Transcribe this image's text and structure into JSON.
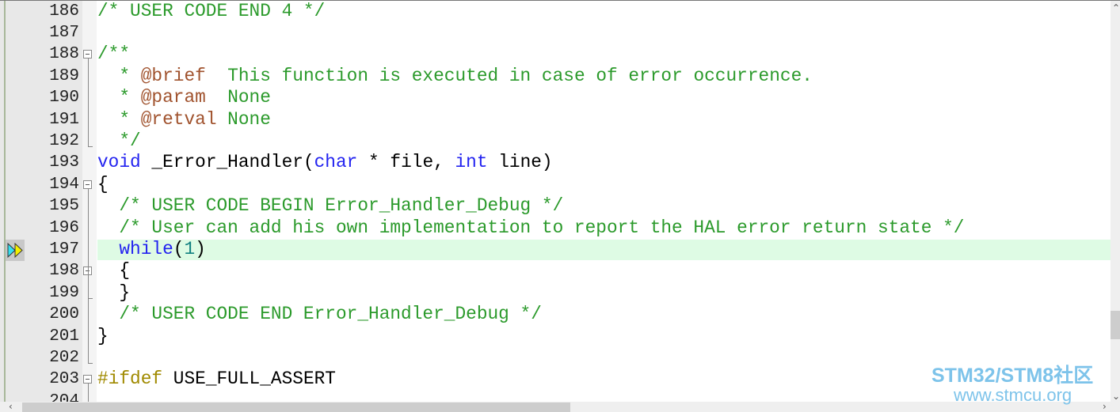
{
  "editor": {
    "current_line": 197,
    "lines": [
      {
        "num": "186",
        "tokens": [
          {
            "c": "c",
            "t": "/* USER CODE END 4 */"
          }
        ]
      },
      {
        "num": "187",
        "tokens": []
      },
      {
        "num": "188",
        "fold": "start",
        "tokens": [
          {
            "c": "c",
            "t": "/**"
          }
        ]
      },
      {
        "num": "189",
        "tokens": [
          {
            "c": "c",
            "t": "  * "
          },
          {
            "c": "d",
            "t": "@brief"
          },
          {
            "c": "c",
            "t": "  This function is executed in case of error occurrence."
          }
        ]
      },
      {
        "num": "190",
        "tokens": [
          {
            "c": "c",
            "t": "  * "
          },
          {
            "c": "d",
            "t": "@param"
          },
          {
            "c": "c",
            "t": "  None"
          }
        ]
      },
      {
        "num": "191",
        "tokens": [
          {
            "c": "c",
            "t": "  * "
          },
          {
            "c": "d",
            "t": "@retval"
          },
          {
            "c": "c",
            "t": " None"
          }
        ]
      },
      {
        "num": "192",
        "fold": "end",
        "tokens": [
          {
            "c": "c",
            "t": "  */"
          }
        ]
      },
      {
        "num": "193",
        "tokens": [
          {
            "c": "k",
            "t": "void"
          },
          {
            "c": "t",
            "t": " _Error_Handler("
          },
          {
            "c": "k",
            "t": "char"
          },
          {
            "c": "t",
            "t": " * file, "
          },
          {
            "c": "k",
            "t": "int"
          },
          {
            "c": "t",
            "t": " line)"
          }
        ]
      },
      {
        "num": "194",
        "fold": "start",
        "tokens": [
          {
            "c": "t",
            "t": "{"
          }
        ]
      },
      {
        "num": "195",
        "tokens": [
          {
            "c": "c",
            "t": "  /* USER CODE BEGIN Error_Handler_Debug */"
          }
        ]
      },
      {
        "num": "196",
        "tokens": [
          {
            "c": "c",
            "t": "  /* User can add his own implementation to report the HAL error return state */"
          }
        ]
      },
      {
        "num": "197",
        "tokens": [
          {
            "c": "t",
            "t": "  "
          },
          {
            "c": "k",
            "t": "while"
          },
          {
            "c": "t",
            "t": "("
          },
          {
            "c": "n",
            "t": "1"
          },
          {
            "c": "t",
            "t": ")"
          }
        ]
      },
      {
        "num": "198",
        "fold": "start",
        "tokens": [
          {
            "c": "t",
            "t": "  {"
          }
        ]
      },
      {
        "num": "199",
        "fold": "end",
        "tokens": [
          {
            "c": "t",
            "t": "  }"
          }
        ]
      },
      {
        "num": "200",
        "tokens": [
          {
            "c": "c",
            "t": "  /* USER CODE END Error_Handler_Debug */"
          }
        ]
      },
      {
        "num": "201",
        "tokens": [
          {
            "c": "t",
            "t": "}"
          }
        ]
      },
      {
        "num": "202",
        "fold": "end",
        "tokens": []
      },
      {
        "num": "203",
        "fold": "start",
        "tokens": [
          {
            "c": "p",
            "t": "#ifdef"
          },
          {
            "c": "t",
            "t": " USE_FULL_ASSERT"
          }
        ]
      },
      {
        "num": "204",
        "tokens": []
      }
    ]
  },
  "debug_marker_icon": "current-execution-arrow-icon",
  "watermark": {
    "title": "STM32/STM8社区",
    "url": "www.stmcu.org"
  },
  "colors": {
    "comment": "#2b9a2b",
    "keyword": "#2323f0",
    "doc_tag": "#a0522d",
    "preprocessor": "#a08a00",
    "number": "#108080",
    "current_line_bg": "#defbe4"
  }
}
